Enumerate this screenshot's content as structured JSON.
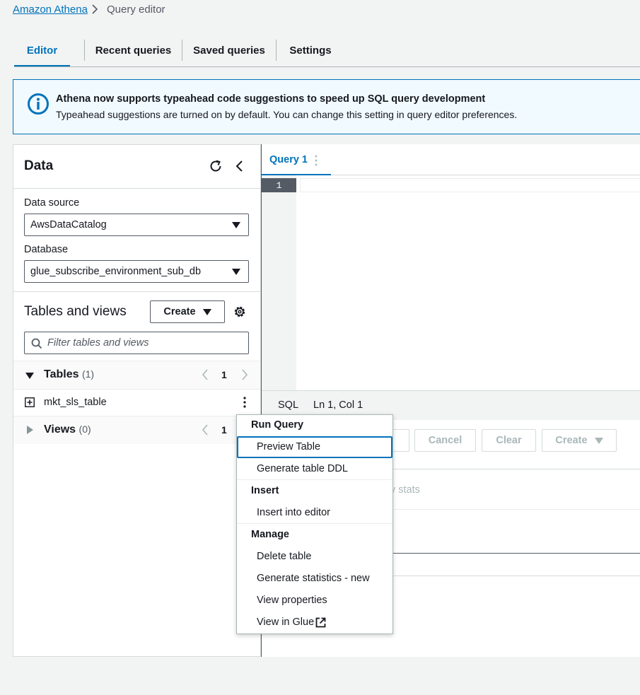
{
  "breadcrumb": {
    "root": "Amazon Athena",
    "current": "Query editor"
  },
  "tabs": [
    {
      "label": "Editor"
    },
    {
      "label": "Recent queries"
    },
    {
      "label": "Saved queries"
    },
    {
      "label": "Settings"
    }
  ],
  "flash": {
    "title": "Athena now supports typeahead code suggestions to speed up SQL query development",
    "body": "Typeahead suggestions are turned on by default. You can change this setting in query editor preferences."
  },
  "data_panel": {
    "title": "Data",
    "data_source": {
      "label": "Data source",
      "value": "AwsDataCatalog"
    },
    "database": {
      "label": "Database",
      "value": "glue_subscribe_environment_sub_db"
    },
    "tables_views_title": "Tables and views",
    "create_label": "Create",
    "filter_placeholder": "Filter tables and views",
    "tables": {
      "title": "Tables",
      "count": "(1)",
      "page": "1",
      "items": [
        "mkt_sls_table"
      ]
    },
    "views": {
      "title": "Views",
      "count": "(0)",
      "page": "1"
    }
  },
  "editor": {
    "query_tab": "Query 1",
    "line_number": "1",
    "status_lang": "SQL",
    "status_pos": "Ln 1, Col 1",
    "buttons": {
      "cancel": "Cancel",
      "clear": "Clear",
      "create": "Create"
    },
    "partial_stats": "y stats"
  },
  "context_menu": {
    "run_query_header": "Run Query",
    "preview_table": "Preview Table",
    "generate_ddl": "Generate table DDL",
    "insert_header": "Insert",
    "insert_into_editor": "Insert into editor",
    "manage_header": "Manage",
    "delete_table": "Delete table",
    "generate_statistics": "Generate statistics - new",
    "view_properties": "View properties",
    "view_in_glue": "View in Glue"
  },
  "colors": {
    "link": "#0073bb",
    "info_bg": "#f1faff",
    "page_bg": "#f2f3f3",
    "gutter": "#545b64"
  }
}
